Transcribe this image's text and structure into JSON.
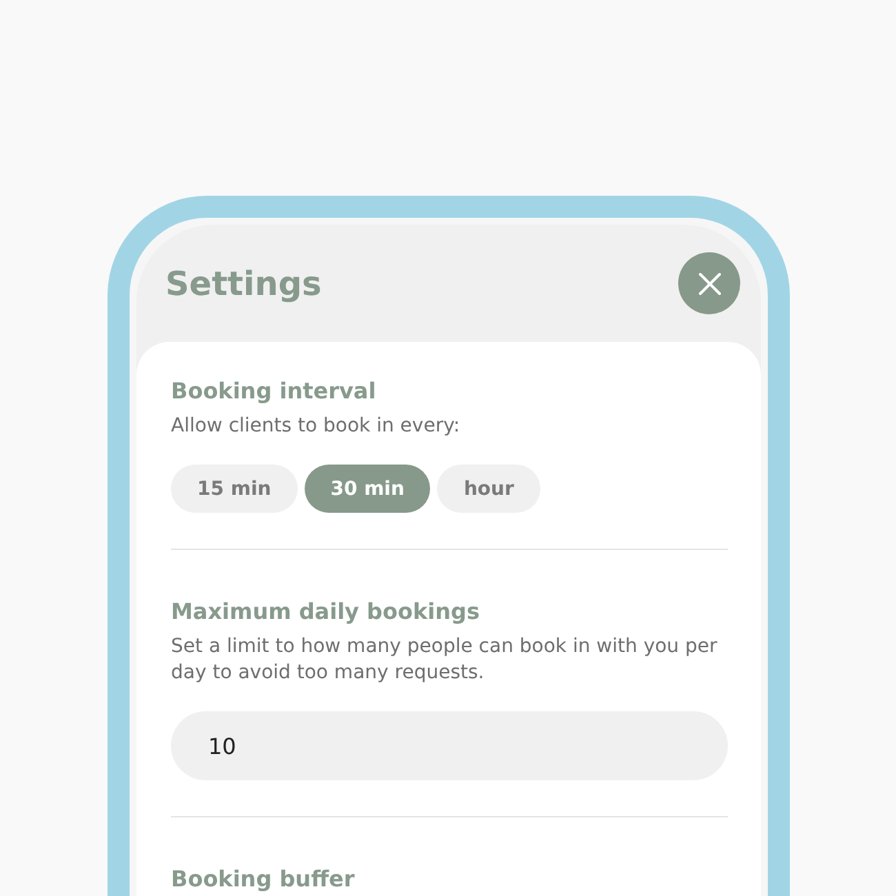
{
  "header": {
    "title": "Settings"
  },
  "sections": [
    {
      "kind": "options",
      "title": "Booking interval",
      "description": "Allow clients to book in every:",
      "options": [
        {
          "label": "15 min",
          "selected": false
        },
        {
          "label": "30 min",
          "selected": true
        },
        {
          "label": "hour",
          "selected": false
        }
      ]
    },
    {
      "kind": "input",
      "title": "Maximum daily bookings",
      "description": "Set a limit to how many people can book in with you per day to avoid too many requests.",
      "value": "10"
    },
    {
      "kind": "heading",
      "title": "Booking buffer"
    }
  ]
}
